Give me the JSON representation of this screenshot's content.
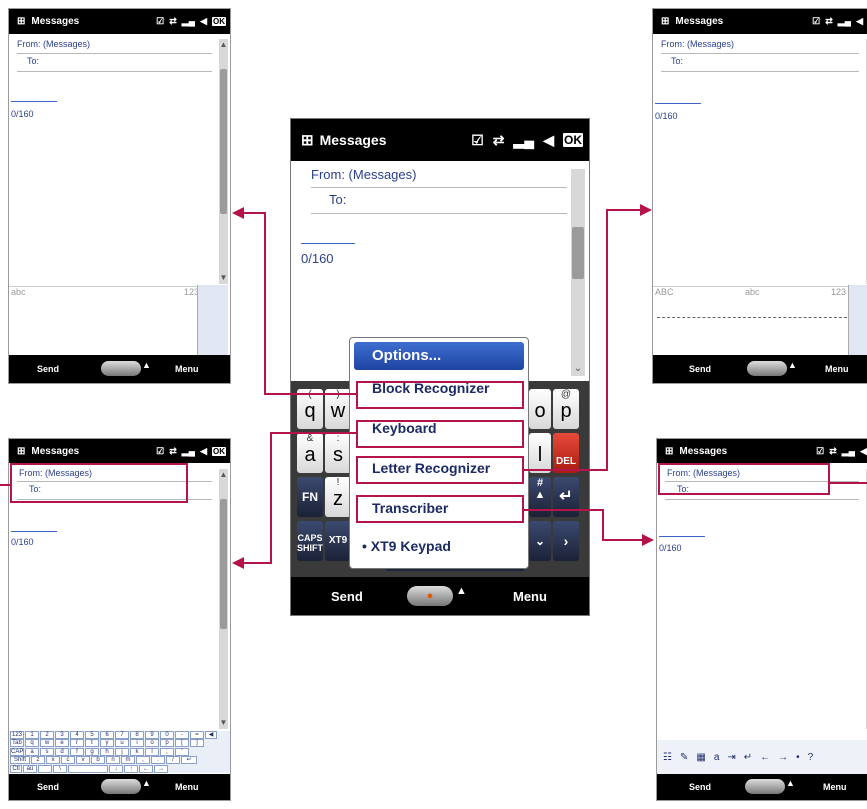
{
  "common": {
    "app_title": "Messages",
    "from_label": "From: (Messages)",
    "to_label": "To:",
    "counter": "0/160",
    "send": "Send",
    "menu": "Menu",
    "ok": "OK"
  },
  "top_left": {
    "abc": "abc",
    "num": "123"
  },
  "top_right": {
    "abc_upper": "ABC",
    "abc": "abc",
    "num": "123"
  },
  "center": {
    "menu_items": [
      "Options...",
      "Block Recognizer",
      "Keyboard",
      "Letter Recognizer",
      "Transcriber",
      "XT9 Keypad"
    ],
    "selected_marker": "•",
    "keys": {
      "row1": [
        {
          "top": "(",
          "main": "q"
        },
        {
          "top": ")",
          "main": "w"
        }
      ],
      "row1_right": [
        {
          "top": "@",
          "main": "p"
        }
      ],
      "row2": [
        {
          "top": "&",
          "main": "a"
        },
        {
          "top": ":",
          "main": "s"
        }
      ],
      "row3_right": [
        "#"
      ],
      "fn": "FN",
      "z_top": "!",
      "z": "z",
      "caps1": "CAPS",
      "caps2": "SHIFT",
      "xt9": "XT9",
      "del": "DEL",
      "o": "o",
      "l": "l"
    }
  },
  "bottom_left_kb": {
    "row1": [
      "123",
      "1",
      "2",
      "3",
      "4",
      "5",
      "6",
      "7",
      "8",
      "9",
      "0",
      "-",
      "=",
      "◀"
    ],
    "row2": [
      "Tab",
      "q",
      "w",
      "e",
      "r",
      "t",
      "y",
      "u",
      "i",
      "o",
      "p",
      "[",
      "]"
    ],
    "row3": [
      "CAP",
      "a",
      "s",
      "d",
      "f",
      "g",
      "h",
      "j",
      "k",
      "l",
      ";",
      "'"
    ],
    "row4": [
      "Shift",
      "z",
      "x",
      "c",
      "v",
      "b",
      "n",
      "m",
      ",",
      ".",
      "/",
      "↵"
    ],
    "row5": [
      "Ctl",
      "áü",
      "`",
      "\\",
      "",
      "↓",
      "↑",
      "←",
      "→"
    ]
  },
  "colors": {
    "accent": "#b5144a",
    "text_blue": "#2a3f8f",
    "menu_blue": "#2a55bd"
  }
}
